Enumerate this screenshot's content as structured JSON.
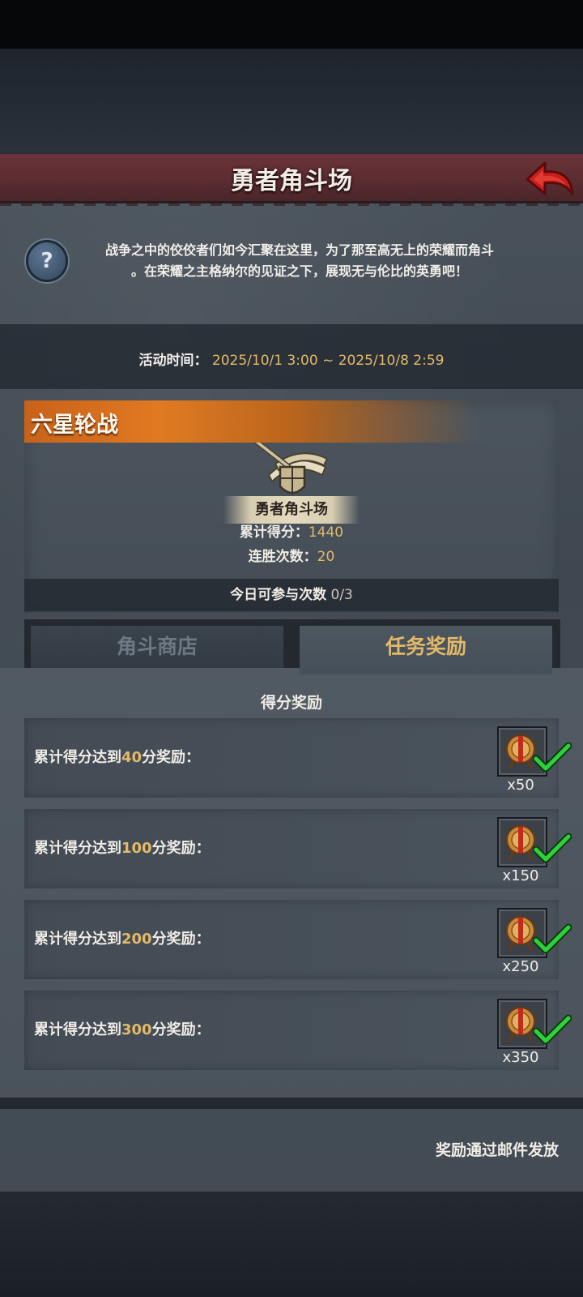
{
  "header": {
    "title": "勇者角斗场",
    "back_icon": "back-arrow-icon"
  },
  "intro": {
    "help_icon": "question-mark-icon",
    "help_glyph": "?",
    "description_line1": "战争之中的佼佼者们如今汇聚在这里，为了那至高无上的荣耀而角斗",
    "description_line2": "。在荣耀之主格纳尔的见证之下，展现无与伦比的英勇吧！"
  },
  "event_time": {
    "label": "活动时间：",
    "value": "2025/10/1 3:00 ~ 2025/10/8 2:59"
  },
  "event": {
    "title": "六星轮战",
    "emblem_icon": "shield-sword-emblem-icon",
    "emblem_label": "勇者角斗场",
    "score_label": "累计得分：",
    "score_value": "1440",
    "streak_label": "连胜次数：",
    "streak_value": "20",
    "attempts_label": "今日可参与次数",
    "attempts_value": "0/3"
  },
  "tabs": [
    {
      "label": "角斗商店",
      "active": false
    },
    {
      "label": "任务奖励",
      "active": true
    }
  ],
  "rewards": {
    "section_title": "得分奖励",
    "items": [
      {
        "prefix": "累计得分达到",
        "score": "40",
        "suffix": "分奖励：",
        "qty": "x50",
        "claimed": true
      },
      {
        "prefix": "累计得分达到",
        "score": "100",
        "suffix": "分奖励：",
        "qty": "x150",
        "claimed": true
      },
      {
        "prefix": "累计得分达到",
        "score": "200",
        "suffix": "分奖励：",
        "qty": "x250",
        "claimed": true
      },
      {
        "prefix": "累计得分达到",
        "score": "300",
        "suffix": "分奖励：",
        "qty": "x350",
        "claimed": true
      }
    ],
    "reward_icon": "arena-medal-icon",
    "claimed_icon": "green-checkmark-icon",
    "mail_note": "奖励通过邮件发放"
  },
  "colors": {
    "accent_gold": "#e3b968",
    "banner_red": "#5a2c31",
    "event_orange": "#e07a22",
    "check_green": "#2fd13b"
  }
}
